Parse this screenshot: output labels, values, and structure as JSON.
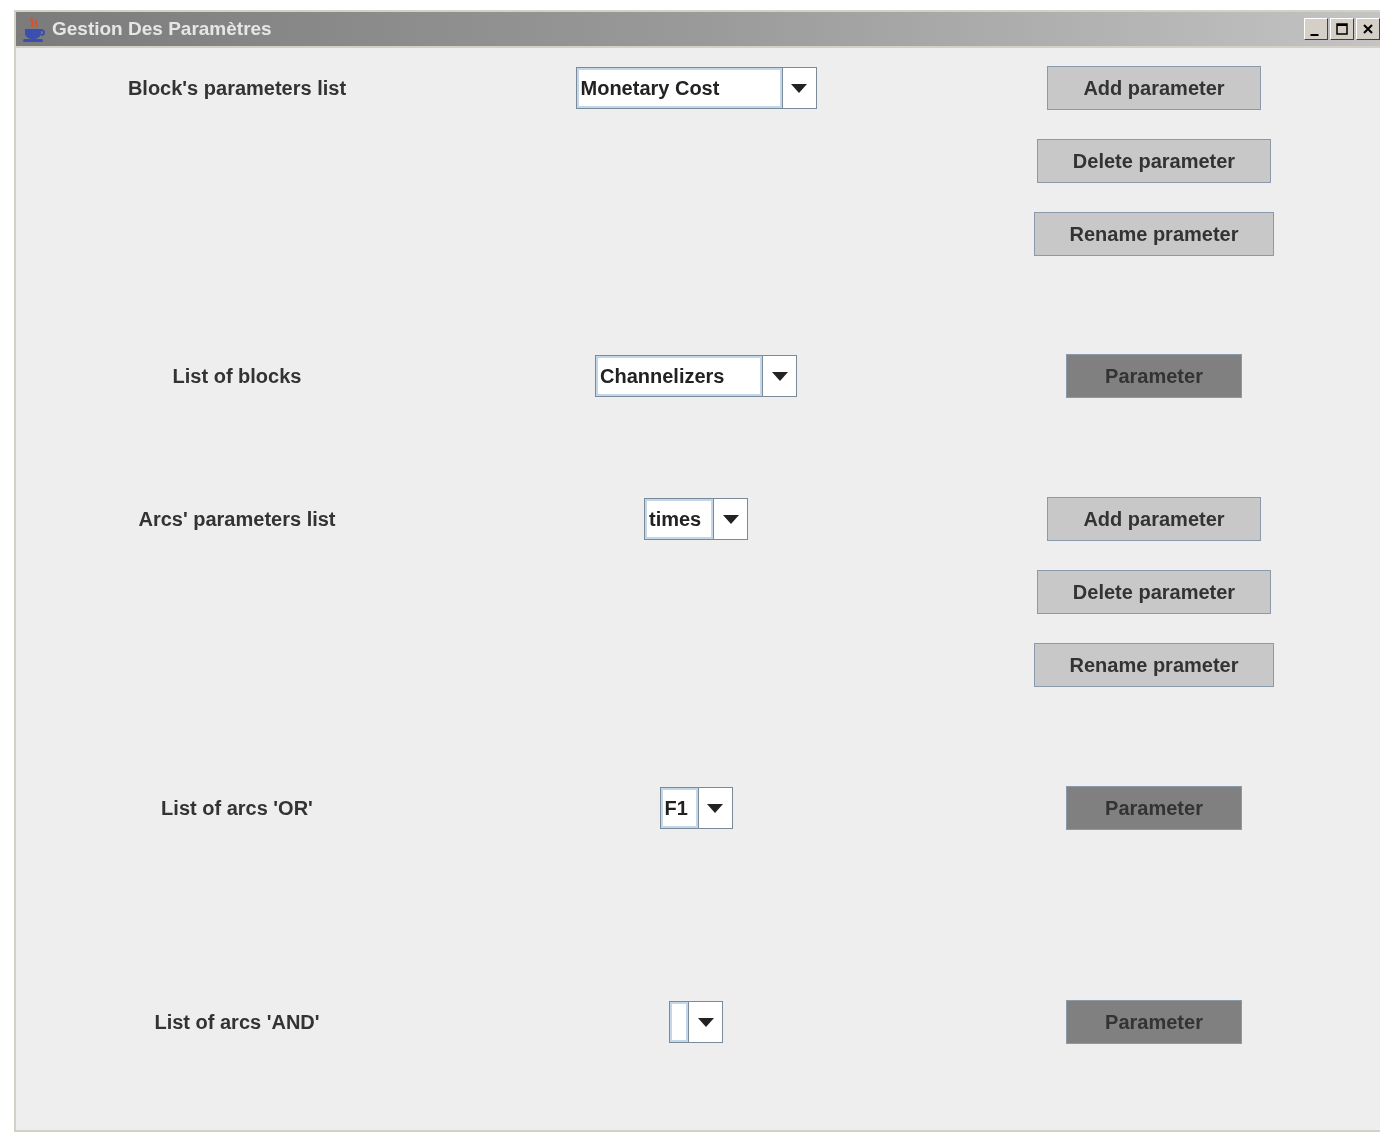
{
  "window": {
    "title": "Gestion Des Paramètres"
  },
  "sections": [
    {
      "label": "Block's parameters list",
      "combo": {
        "value": "Monetary Cost"
      },
      "buttons": [
        {
          "label": "Add parameter",
          "kind": "plain"
        },
        {
          "label": "Delete parameter",
          "kind": "plain"
        },
        {
          "label": "Rename prameter",
          "kind": "plain"
        }
      ]
    },
    {
      "label": "List of blocks",
      "combo": {
        "value": "Channelizers"
      },
      "buttons": [
        {
          "label": "Parameter",
          "kind": "dark"
        }
      ]
    },
    {
      "label": "Arcs' parameters list",
      "combo": {
        "value": "times"
      },
      "buttons": [
        {
          "label": "Add parameter",
          "kind": "plain"
        },
        {
          "label": "Delete parameter",
          "kind": "plain"
        },
        {
          "label": "Rename prameter",
          "kind": "plain"
        }
      ]
    },
    {
      "label": "List of arcs 'OR'",
      "combo": {
        "value": "F1"
      },
      "buttons": [
        {
          "label": "Parameter",
          "kind": "dark"
        }
      ]
    },
    {
      "label": "List of arcs 'AND'",
      "buttons": [
        {
          "label": "Parameter",
          "kind": "dark"
        }
      ]
    }
  ]
}
